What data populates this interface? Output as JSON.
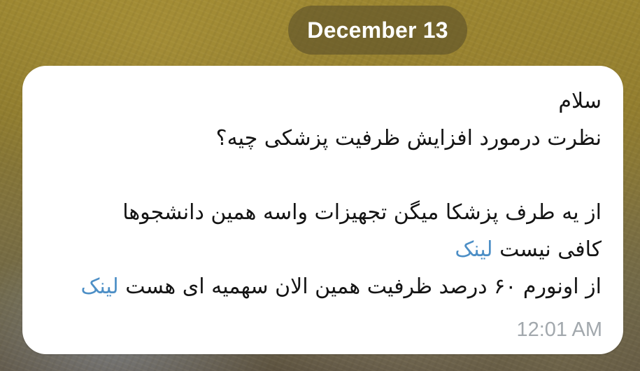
{
  "chat": {
    "date_label": "December 13",
    "message": {
      "line1": "سلام",
      "line2": "نظرت درمورد افزایش ظرفیت پزشکی چیه؟",
      "line3": "از یه طرف پزشکا میگن تجهیزات واسه همین دانشجوها",
      "line4_text": "کافی نیست",
      "line4_link": "لینک",
      "line5_text": "از اونورم ۶۰ درصد ظرفیت همین الان سهمیه ای هست",
      "line5_link": "لینک",
      "time": "12:01 AM"
    },
    "colors": {
      "link": "#4d8fc6",
      "bubble": "#ffffff",
      "time": "#a2a8ad",
      "date_pill": "#5c502a"
    }
  }
}
